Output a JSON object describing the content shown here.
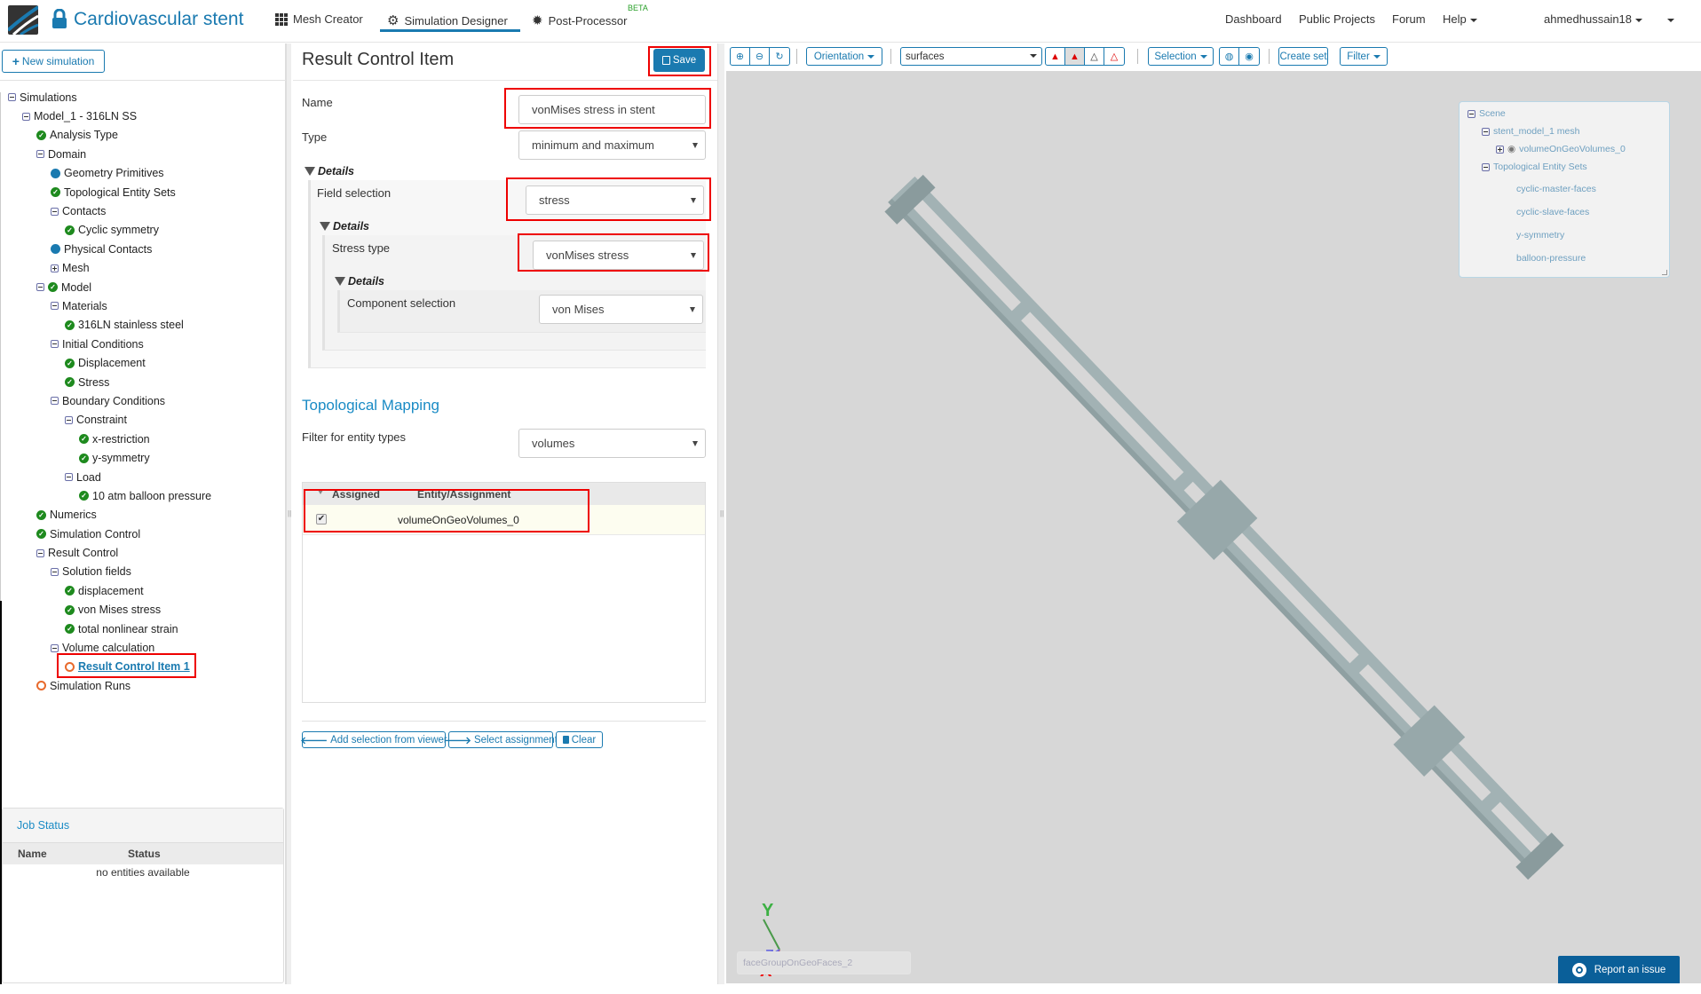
{
  "header": {
    "project_title": "Cardiovascular stent",
    "nav": [
      {
        "label": "Mesh Creator",
        "icon": "grid-icon"
      },
      {
        "label": "Simulation Designer",
        "icon": "gears-icon",
        "active": true
      },
      {
        "label": "Post-Processor",
        "icon": "cog-icon",
        "badge": "BETA"
      }
    ],
    "right_links": [
      "Dashboard",
      "Public Projects",
      "Forum",
      "Help"
    ],
    "user": "ahmedhussain18"
  },
  "left": {
    "new_simulation": "New simulation",
    "tree": [
      {
        "label": "Simulations",
        "level": 0,
        "icon": "minus"
      },
      {
        "label": "Model_1 - 316LN SS",
        "level": 1,
        "icon": "minus"
      },
      {
        "label": "Analysis Type",
        "level": 2,
        "icon": "check"
      },
      {
        "label": "Domain",
        "level": 2,
        "icon": "minus"
      },
      {
        "label": "Geometry Primitives",
        "level": 3,
        "icon": "dot"
      },
      {
        "label": "Topological Entity Sets",
        "level": 3,
        "icon": "check"
      },
      {
        "label": "Contacts",
        "level": 3,
        "icon": "minus"
      },
      {
        "label": "Cyclic symmetry",
        "level": 4,
        "icon": "check"
      },
      {
        "label": "Physical Contacts",
        "level": 3,
        "icon": "dot"
      },
      {
        "label": "Mesh",
        "level": 3,
        "icon": "plus"
      },
      {
        "label": "Model",
        "level": 2,
        "icon": "minus-check"
      },
      {
        "label": "Materials",
        "level": 3,
        "icon": "minus"
      },
      {
        "label": "316LN stainless steel",
        "level": 4,
        "icon": "check"
      },
      {
        "label": "Initial Conditions",
        "level": 3,
        "icon": "minus"
      },
      {
        "label": "Displacement",
        "level": 4,
        "icon": "check"
      },
      {
        "label": "Stress",
        "level": 4,
        "icon": "check"
      },
      {
        "label": "Boundary Conditions",
        "level": 3,
        "icon": "minus"
      },
      {
        "label": "Constraint",
        "level": 4,
        "icon": "minus"
      },
      {
        "label": "x-restriction",
        "level": 5,
        "icon": "check"
      },
      {
        "label": "y-symmetry",
        "level": 5,
        "icon": "check"
      },
      {
        "label": "Load",
        "level": 4,
        "icon": "minus"
      },
      {
        "label": "10 atm balloon pressure",
        "level": 5,
        "icon": "check"
      },
      {
        "label": "Numerics",
        "level": 2,
        "icon": "check"
      },
      {
        "label": "Simulation Control",
        "level": 2,
        "icon": "check"
      },
      {
        "label": "Result Control",
        "level": 2,
        "icon": "minus"
      },
      {
        "label": "Solution fields",
        "level": 3,
        "icon": "minus"
      },
      {
        "label": "displacement",
        "level": 4,
        "icon": "check"
      },
      {
        "label": "von Mises stress",
        "level": 4,
        "icon": "check"
      },
      {
        "label": "total nonlinear strain",
        "level": 4,
        "icon": "check"
      },
      {
        "label": "Volume calculation",
        "level": 3,
        "icon": "minus"
      },
      {
        "label": "Result Control Item 1",
        "level": 4,
        "icon": "ring",
        "selected": true
      },
      {
        "label": "Simulation Runs",
        "level": 2,
        "icon": "ring"
      }
    ],
    "job_status": {
      "title": "Job Status",
      "columns": [
        "Name",
        "Status"
      ],
      "empty": "no entities available"
    }
  },
  "form": {
    "title": "Result Control Item",
    "save": "Save",
    "name_label": "Name",
    "name_value": "vonMises stress in stent",
    "type_label": "Type",
    "type_value": "minimum and maximum",
    "details": "Details",
    "field_selection_label": "Field selection",
    "field_selection_value": "stress",
    "stress_type_label": "Stress type",
    "stress_type_value": "vonMises stress",
    "component_label": "Component selection",
    "component_value": "von Mises",
    "mapping_title": "Topological Mapping",
    "filter_label": "Filter for entity types",
    "filter_value": "volumes",
    "table_columns": [
      "Assigned",
      "Entity/Assignment"
    ],
    "rows": [
      {
        "assigned": true,
        "entity": "volumeOnGeoVolumes_0"
      }
    ],
    "add_selection": "Add selection from viewer",
    "select_assignment": "Select assignment",
    "clear": "Clear"
  },
  "viewer": {
    "orientation": "Orientation",
    "render_mode": "surfaces",
    "selection": "Selection",
    "create_set": "Create set",
    "filter": "Filter",
    "scene": {
      "root": "Scene",
      "mesh": "stent_model_1 mesh",
      "volume": "volumeOnGeoVolumes_0",
      "sets_title": "Topological Entity Sets",
      "sets": [
        "cyclic-master-faces",
        "cyclic-slave-faces",
        "y-symmetry",
        "balloon-pressure"
      ]
    },
    "axes": {
      "x": "X",
      "y": "Y",
      "z": "Z"
    },
    "hover_field": "faceGroupOnGeoFaces_2",
    "report_issue": "Report an issue"
  },
  "colors": {
    "accent": "#1a7ab0",
    "highlight": "#ee0000",
    "ok": "#1e8a1e",
    "pending": "#e86a2c",
    "viewport": "#d7d7d7",
    "stent": "#9aabad"
  }
}
